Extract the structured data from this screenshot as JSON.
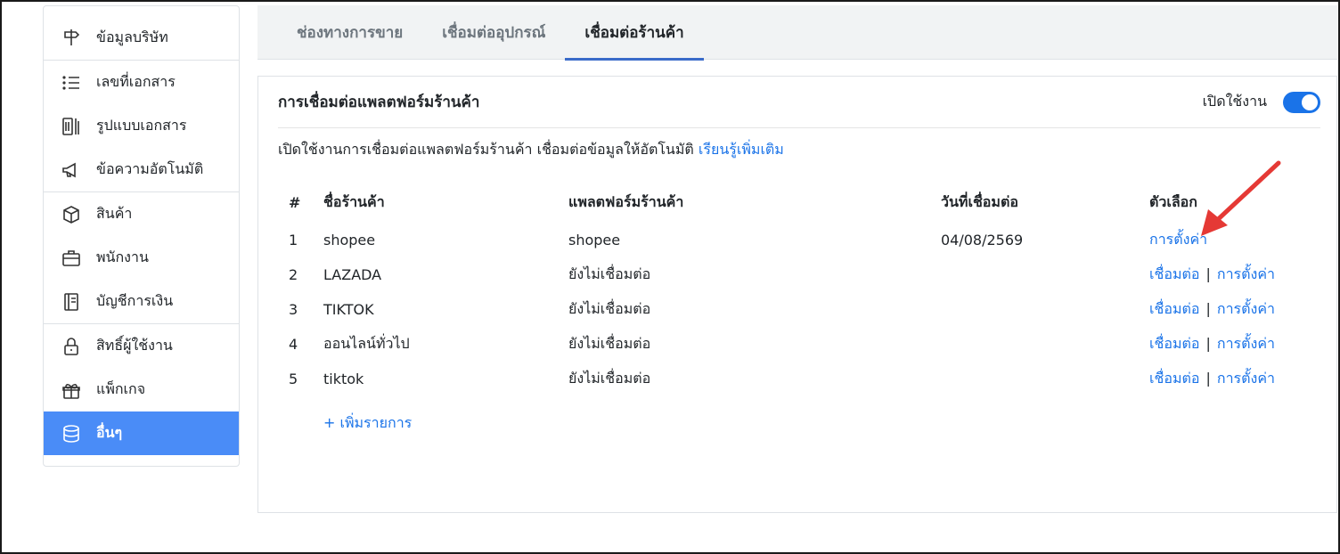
{
  "sidebar": {
    "groups": [
      [
        {
          "label": "ข้อมูลบริษัท",
          "icon": "signpost-icon"
        }
      ],
      [
        {
          "label": "เลขที่เอกสาร",
          "icon": "list-icon"
        },
        {
          "label": "รูปแบบเอกสาร",
          "icon": "document-tools-icon"
        },
        {
          "label": "ข้อความอัตโนมัติ",
          "icon": "megaphone-icon"
        }
      ],
      [
        {
          "label": "สินค้า",
          "icon": "box-icon"
        },
        {
          "label": "พนักงาน",
          "icon": "briefcase-icon"
        },
        {
          "label": "บัญชีการเงิน",
          "icon": "ledger-icon"
        }
      ],
      [
        {
          "label": "สิทธิ์ผู้ใช้งาน",
          "icon": "lock-icon"
        },
        {
          "label": "แพ็กเกจ",
          "icon": "gift-icon"
        },
        {
          "label": "อื่นๆ",
          "icon": "database-icon",
          "active": true
        }
      ]
    ]
  },
  "tabs": [
    {
      "label": "ช่องทางการขาย"
    },
    {
      "label": "เชื่อมต่ออุปกรณ์"
    },
    {
      "label": "เชื่อมต่อร้านค้า",
      "active": true
    }
  ],
  "card": {
    "title": "การเชื่อมต่อแพลตฟอร์มร้านค้า",
    "toggle_label": "เปิดใช้งาน",
    "toggle_on": true,
    "description": "เปิดใช้งานการเชื่อมต่อแพลตฟอร์มร้านค้า เชื่อมต่อข้อมูลให้อัตโนมัติ",
    "learn_more": "เรียนรู้เพิ่มเติม"
  },
  "table": {
    "headers": [
      "#",
      "ชื่อร้านค้า",
      "แพลตฟอร์มร้านค้า",
      "วันที่เชื่อมต่อ",
      "ตัวเลือก"
    ],
    "rows": [
      {
        "num": "1",
        "name": "shopee",
        "platform": "shopee",
        "date": "04/08/2569",
        "connect": "",
        "settings": "การตั้งค่า"
      },
      {
        "num": "2",
        "name": "LAZADA",
        "platform": "ยังไม่เชื่อมต่อ",
        "date": "",
        "connect": "เชื่อมต่อ",
        "settings": "การตั้งค่า"
      },
      {
        "num": "3",
        "name": "TIKTOK",
        "platform": "ยังไม่เชื่อมต่อ",
        "date": "",
        "connect": "เชื่อมต่อ",
        "settings": "การตั้งค่า"
      },
      {
        "num": "4",
        "name": "ออนไลน์ทั่วไป",
        "platform": "ยังไม่เชื่อมต่อ",
        "date": "",
        "connect": "เชื่อมต่อ",
        "settings": "การตั้งค่า"
      },
      {
        "num": "5",
        "name": "tiktok",
        "platform": "ยังไม่เชื่อมต่อ",
        "date": "",
        "connect": "เชื่อมต่อ",
        "settings": "การตั้งค่า"
      }
    ],
    "separator": "|",
    "add_label": "+ เพิ่มรายการ"
  },
  "colors": {
    "accent": "#1a73e8",
    "sidebar_active": "#4a8cf7",
    "annotation_arrow": "#e53935"
  }
}
